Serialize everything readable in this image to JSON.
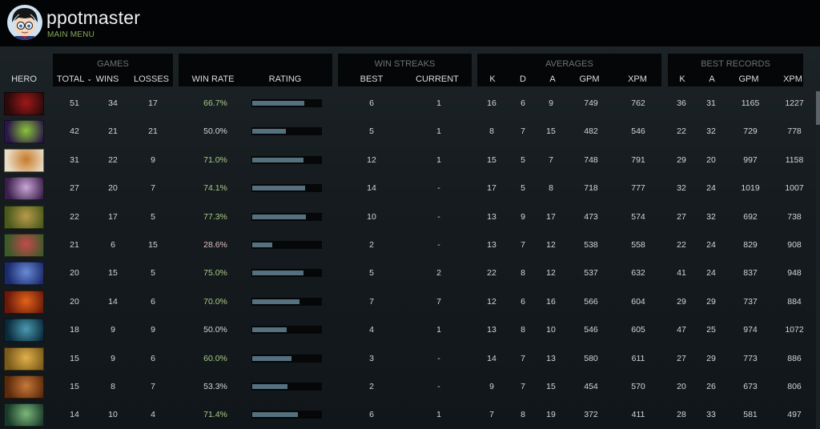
{
  "user": {
    "name": "ppotmaster",
    "menu_link": "MAIN MENU"
  },
  "headers": {
    "groups": {
      "games": "GAMES",
      "win_streaks": "WIN STREAKS",
      "averages": "AVERAGES",
      "best_records": "BEST RECORDS"
    },
    "columns": {
      "hero": "HERO",
      "total": "TOTAL",
      "wins": "WINS",
      "losses": "LOSSES",
      "win_rate": "WIN RATE",
      "rating": "RATING",
      "best": "BEST",
      "current": "CURRENT",
      "avg_k": "K",
      "avg_d": "D",
      "avg_a": "A",
      "avg_gpm": "GPM",
      "avg_xpm": "XPM",
      "rec_k": "K",
      "rec_a": "A",
      "rec_gpm": "GPM",
      "rec_xpm": "XPM"
    }
  },
  "rows": [
    {
      "hero_colors": [
        "#2a0a0a",
        "#a01818"
      ],
      "total": "51",
      "wins": "34",
      "losses": "17",
      "win_rate": "66.7%",
      "rating": 0.75,
      "best": "6",
      "current": "1",
      "k": "16",
      "d": "6",
      "a": "9",
      "gpm": "749",
      "xpm": "762",
      "rk": "36",
      "ra": "31",
      "rgpm": "1165",
      "rxpm": "1227"
    },
    {
      "hero_colors": [
        "#2a1648",
        "#8bc43a"
      ],
      "total": "42",
      "wins": "21",
      "losses": "21",
      "win_rate": "50.0%",
      "rating": 0.49,
      "best": "5",
      "current": "1",
      "k": "8",
      "d": "7",
      "a": "15",
      "gpm": "482",
      "xpm": "546",
      "rk": "22",
      "ra": "32",
      "rgpm": "729",
      "rxpm": "778"
    },
    {
      "hero_colors": [
        "#e8dcc4",
        "#c87a2a"
      ],
      "total": "31",
      "wins": "22",
      "losses": "9",
      "win_rate": "71.0%",
      "rating": 0.74,
      "best": "12",
      "current": "1",
      "k": "15",
      "d": "5",
      "a": "7",
      "gpm": "748",
      "xpm": "791",
      "rk": "29",
      "ra": "20",
      "rgpm": "997",
      "rxpm": "1158"
    },
    {
      "hero_colors": [
        "#3b1f4a",
        "#c9a6d6"
      ],
      "total": "27",
      "wins": "20",
      "losses": "7",
      "win_rate": "74.1%",
      "rating": 0.77,
      "best": "14",
      "current": "-",
      "k": "17",
      "d": "5",
      "a": "8",
      "gpm": "718",
      "xpm": "777",
      "rk": "32",
      "ra": "24",
      "rgpm": "1019",
      "rxpm": "1007"
    },
    {
      "hero_colors": [
        "#4a5a1c",
        "#b89a4a"
      ],
      "total": "22",
      "wins": "17",
      "losses": "5",
      "win_rate": "77.3%",
      "rating": 0.78,
      "best": "10",
      "current": "-",
      "k": "13",
      "d": "9",
      "a": "17",
      "gpm": "473",
      "xpm": "574",
      "rk": "27",
      "ra": "32",
      "rgpm": "692",
      "rxpm": "738"
    },
    {
      "hero_colors": [
        "#3c5a2a",
        "#c44a4a"
      ],
      "total": "21",
      "wins": "6",
      "losses": "15",
      "win_rate": "28.6%",
      "rating": 0.29,
      "best": "2",
      "current": "-",
      "k": "13",
      "d": "7",
      "a": "12",
      "gpm": "538",
      "xpm": "558",
      "rk": "22",
      "ra": "24",
      "rgpm": "829",
      "rxpm": "908"
    },
    {
      "hero_colors": [
        "#1a2a6a",
        "#6a8ad8"
      ],
      "total": "20",
      "wins": "15",
      "losses": "5",
      "win_rate": "75.0%",
      "rating": 0.74,
      "best": "5",
      "current": "2",
      "k": "22",
      "d": "8",
      "a": "12",
      "gpm": "537",
      "xpm": "632",
      "rk": "41",
      "ra": "24",
      "rgpm": "837",
      "rxpm": "948"
    },
    {
      "hero_colors": [
        "#6a1a0a",
        "#e2631a"
      ],
      "total": "20",
      "wins": "14",
      "losses": "6",
      "win_rate": "70.0%",
      "rating": 0.69,
      "best": "7",
      "current": "7",
      "k": "12",
      "d": "6",
      "a": "16",
      "gpm": "566",
      "xpm": "604",
      "rk": "29",
      "ra": "29",
      "rgpm": "737",
      "rxpm": "884"
    },
    {
      "hero_colors": [
        "#0a2a3a",
        "#4a9ab0"
      ],
      "total": "18",
      "wins": "9",
      "losses": "9",
      "win_rate": "50.0%",
      "rating": 0.5,
      "best": "4",
      "current": "1",
      "k": "13",
      "d": "8",
      "a": "10",
      "gpm": "546",
      "xpm": "605",
      "rk": "47",
      "ra": "25",
      "rgpm": "974",
      "rxpm": "1072"
    },
    {
      "hero_colors": [
        "#7a5a1a",
        "#e0b04a"
      ],
      "total": "15",
      "wins": "9",
      "losses": "6",
      "win_rate": "60.0%",
      "rating": 0.57,
      "best": "3",
      "current": "-",
      "k": "14",
      "d": "7",
      "a": "13",
      "gpm": "580",
      "xpm": "611",
      "rk": "27",
      "ra": "29",
      "rgpm": "773",
      "rxpm": "886"
    },
    {
      "hero_colors": [
        "#5a2a0a",
        "#c8783a"
      ],
      "total": "15",
      "wins": "8",
      "losses": "7",
      "win_rate": "53.3%",
      "rating": 0.51,
      "best": "2",
      "current": "-",
      "k": "9",
      "d": "7",
      "a": "15",
      "gpm": "454",
      "xpm": "570",
      "rk": "20",
      "ra": "26",
      "rgpm": "673",
      "rxpm": "806"
    },
    {
      "hero_colors": [
        "#1a3a2a",
        "#7ab87a"
      ],
      "total": "14",
      "wins": "10",
      "losses": "4",
      "win_rate": "71.4%",
      "rating": 0.66,
      "best": "6",
      "current": "1",
      "k": "7",
      "d": "8",
      "a": "19",
      "gpm": "372",
      "xpm": "411",
      "rk": "28",
      "ra": "33",
      "rgpm": "581",
      "rxpm": "497"
    }
  ]
}
